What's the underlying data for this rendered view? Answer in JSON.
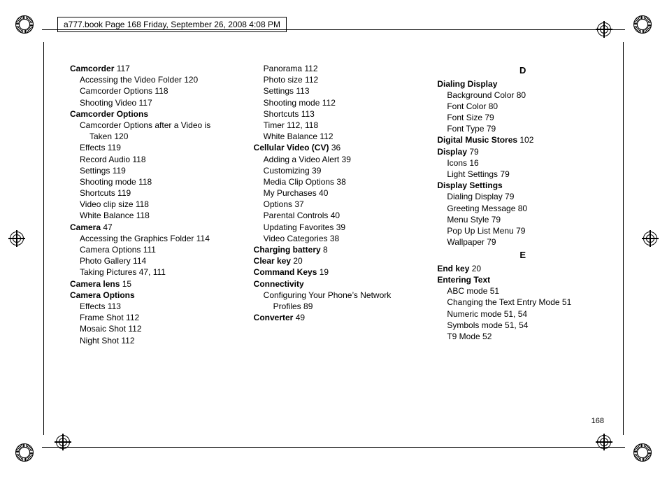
{
  "header_text": "a777.book  Page 168  Friday, September 26, 2008  4:08 PM",
  "page_number": "168",
  "columns": [
    [
      {
        "bold": true,
        "indent": 0,
        "text": "Camcorder",
        "page": "117"
      },
      {
        "bold": false,
        "indent": 1,
        "text": "Accessing the Video Folder",
        "page": "120"
      },
      {
        "bold": false,
        "indent": 1,
        "text": "Camcorder Options",
        "page": "118"
      },
      {
        "bold": false,
        "indent": 1,
        "text": "Shooting Video",
        "page": "117"
      },
      {
        "bold": true,
        "indent": 0,
        "text": "Camcorder Options",
        "page": ""
      },
      {
        "bold": false,
        "indent": 1,
        "text": "Camcorder Options after a Video is",
        "page": ""
      },
      {
        "bold": false,
        "indent": 2,
        "text": "Taken",
        "page": "120"
      },
      {
        "bold": false,
        "indent": 1,
        "text": "Effects",
        "page": "119"
      },
      {
        "bold": false,
        "indent": 1,
        "text": "Record Audio",
        "page": "118"
      },
      {
        "bold": false,
        "indent": 1,
        "text": "Settings",
        "page": "119"
      },
      {
        "bold": false,
        "indent": 1,
        "text": "Shooting mode",
        "page": "118"
      },
      {
        "bold": false,
        "indent": 1,
        "text": "Shortcuts",
        "page": "119"
      },
      {
        "bold": false,
        "indent": 1,
        "text": "Video clip size",
        "page": "118"
      },
      {
        "bold": false,
        "indent": 1,
        "text": "White Balance",
        "page": "118"
      },
      {
        "bold": true,
        "indent": 0,
        "text": "Camera",
        "page": "47"
      },
      {
        "bold": false,
        "indent": 1,
        "text": "Accessing the Graphics Folder",
        "page": "114"
      },
      {
        "bold": false,
        "indent": 1,
        "text": "Camera Options",
        "page": "111"
      },
      {
        "bold": false,
        "indent": 1,
        "text": "Photo Gallery",
        "page": "114"
      },
      {
        "bold": false,
        "indent": 1,
        "text": "Taking Pictures",
        "page": "47, 111"
      },
      {
        "bold": true,
        "indent": 0,
        "text": "Camera lens",
        "page": "15"
      },
      {
        "bold": true,
        "indent": 0,
        "text": "Camera Options",
        "page": ""
      },
      {
        "bold": false,
        "indent": 1,
        "text": "Effects",
        "page": "113"
      },
      {
        "bold": false,
        "indent": 1,
        "text": "Frame Shot",
        "page": "112"
      },
      {
        "bold": false,
        "indent": 1,
        "text": "Mosaic Shot",
        "page": "112"
      },
      {
        "bold": false,
        "indent": 1,
        "text": "Night Shot",
        "page": "112"
      }
    ],
    [
      {
        "bold": false,
        "indent": 1,
        "text": "Panorama",
        "page": "112"
      },
      {
        "bold": false,
        "indent": 1,
        "text": "Photo size",
        "page": "112"
      },
      {
        "bold": false,
        "indent": 1,
        "text": "Settings",
        "page": "113"
      },
      {
        "bold": false,
        "indent": 1,
        "text": "Shooting mode",
        "page": "112"
      },
      {
        "bold": false,
        "indent": 1,
        "text": "Shortcuts",
        "page": "113"
      },
      {
        "bold": false,
        "indent": 1,
        "text": "Timer",
        "page": "112, 118"
      },
      {
        "bold": false,
        "indent": 1,
        "text": "White Balance",
        "page": "112"
      },
      {
        "bold": true,
        "indent": 0,
        "text": "Cellular Video (CV)",
        "page": "36"
      },
      {
        "bold": false,
        "indent": 1,
        "text": "Adding a Video Alert",
        "page": "39"
      },
      {
        "bold": false,
        "indent": 1,
        "text": "Customizing",
        "page": "39"
      },
      {
        "bold": false,
        "indent": 1,
        "text": "Media Clip Options",
        "page": "38"
      },
      {
        "bold": false,
        "indent": 1,
        "text": "My Purchases",
        "page": "40"
      },
      {
        "bold": false,
        "indent": 1,
        "text": "Options",
        "page": "37"
      },
      {
        "bold": false,
        "indent": 1,
        "text": "Parental Controls",
        "page": "40"
      },
      {
        "bold": false,
        "indent": 1,
        "text": "Updating Favorites",
        "page": "39"
      },
      {
        "bold": false,
        "indent": 1,
        "text": "Video Categories",
        "page": "38"
      },
      {
        "bold": true,
        "indent": 0,
        "text": "Charging battery",
        "page": "8"
      },
      {
        "bold": true,
        "indent": 0,
        "text": "Clear key",
        "page": "20"
      },
      {
        "bold": true,
        "indent": 0,
        "text": "Command Keys",
        "page": "19"
      },
      {
        "bold": true,
        "indent": 0,
        "text": "Connectivity",
        "page": ""
      },
      {
        "bold": false,
        "indent": 1,
        "text": "Configuring Your Phone’s Network",
        "page": ""
      },
      {
        "bold": false,
        "indent": 2,
        "text": "Profiles",
        "page": "89"
      },
      {
        "bold": true,
        "indent": 0,
        "text": "Converter",
        "page": "49"
      }
    ],
    [
      {
        "letter": "D"
      },
      {
        "bold": true,
        "indent": 0,
        "text": "Dialing Display",
        "page": ""
      },
      {
        "bold": false,
        "indent": 1,
        "text": "Background Color",
        "page": "80"
      },
      {
        "bold": false,
        "indent": 1,
        "text": "Font Color",
        "page": "80"
      },
      {
        "bold": false,
        "indent": 1,
        "text": "Font Size",
        "page": "79"
      },
      {
        "bold": false,
        "indent": 1,
        "text": "Font Type",
        "page": "79"
      },
      {
        "bold": true,
        "indent": 0,
        "text": "Digital Music Stores",
        "page": "102"
      },
      {
        "bold": true,
        "indent": 0,
        "text": "Display",
        "page": "79"
      },
      {
        "bold": false,
        "indent": 1,
        "text": "Icons",
        "page": "16"
      },
      {
        "bold": false,
        "indent": 1,
        "text": "Light Settings",
        "page": "79"
      },
      {
        "bold": true,
        "indent": 0,
        "text": "Display Settings",
        "page": ""
      },
      {
        "bold": false,
        "indent": 1,
        "text": "Dialing Display",
        "page": "79"
      },
      {
        "bold": false,
        "indent": 1,
        "text": "Greeting Message",
        "page": "80"
      },
      {
        "bold": false,
        "indent": 1,
        "text": "Menu Style",
        "page": "79"
      },
      {
        "bold": false,
        "indent": 1,
        "text": "Pop Up List Menu",
        "page": "79"
      },
      {
        "bold": false,
        "indent": 1,
        "text": "Wallpaper",
        "page": "79"
      },
      {
        "letter": "E"
      },
      {
        "bold": true,
        "indent": 0,
        "text": "End key",
        "page": "20"
      },
      {
        "bold": true,
        "indent": 0,
        "text": "Entering Text",
        "page": ""
      },
      {
        "bold": false,
        "indent": 1,
        "text": "ABC mode",
        "page": "51"
      },
      {
        "bold": false,
        "indent": 1,
        "text": "Changing the Text Entry Mode",
        "page": "51"
      },
      {
        "bold": false,
        "indent": 1,
        "text": "Numeric mode",
        "page": "51, 54"
      },
      {
        "bold": false,
        "indent": 1,
        "text": "Symbols mode",
        "page": "51, 54"
      },
      {
        "bold": false,
        "indent": 1,
        "text": "T9 Mode",
        "page": "52"
      }
    ]
  ]
}
